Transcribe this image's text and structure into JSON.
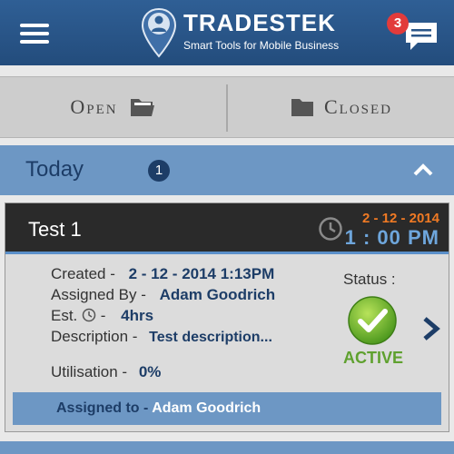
{
  "header": {
    "brand_name": "TRADESTEK",
    "brand_tagline": "Smart Tools for Mobile Business",
    "notification_count": "3",
    "icons": {
      "menu": "hamburger-menu-icon",
      "chat": "chat-icon",
      "logo": "location-pin-person-icon"
    }
  },
  "tabs": {
    "open": {
      "label": "Open",
      "icon": "folder-open-icon"
    },
    "closed": {
      "label": "Closed",
      "icon": "folder-closed-icon"
    }
  },
  "section": {
    "label": "Today",
    "count": "1",
    "icon": "chevron-up-icon"
  },
  "job": {
    "title": "Test 1",
    "date": "2 - 12 - 2014",
    "time": "1 : 00 PM",
    "created_label": "Created -",
    "created_value": "2 - 12 - 2014  1:13PM",
    "assigned_by_label": "Assigned By -",
    "assigned_by_value": "Adam Goodrich",
    "est_label": "Est.",
    "est_suffix": "-",
    "est_value": "4hrs",
    "description_label": "Description -",
    "description_value": "Test description...",
    "utilisation_label": "Utilisation -",
    "utilisation_value": "0%",
    "status_label": "Status :",
    "status_value": "ACTIVE",
    "assigned_to_label": "Assigned to - ",
    "assigned_to_value": "Adam Goodrich"
  },
  "colors": {
    "header_blue": "#2a5689",
    "accent_blue": "#6d97c4",
    "date_orange": "#f07a24",
    "active_green": "#5fa12f"
  }
}
